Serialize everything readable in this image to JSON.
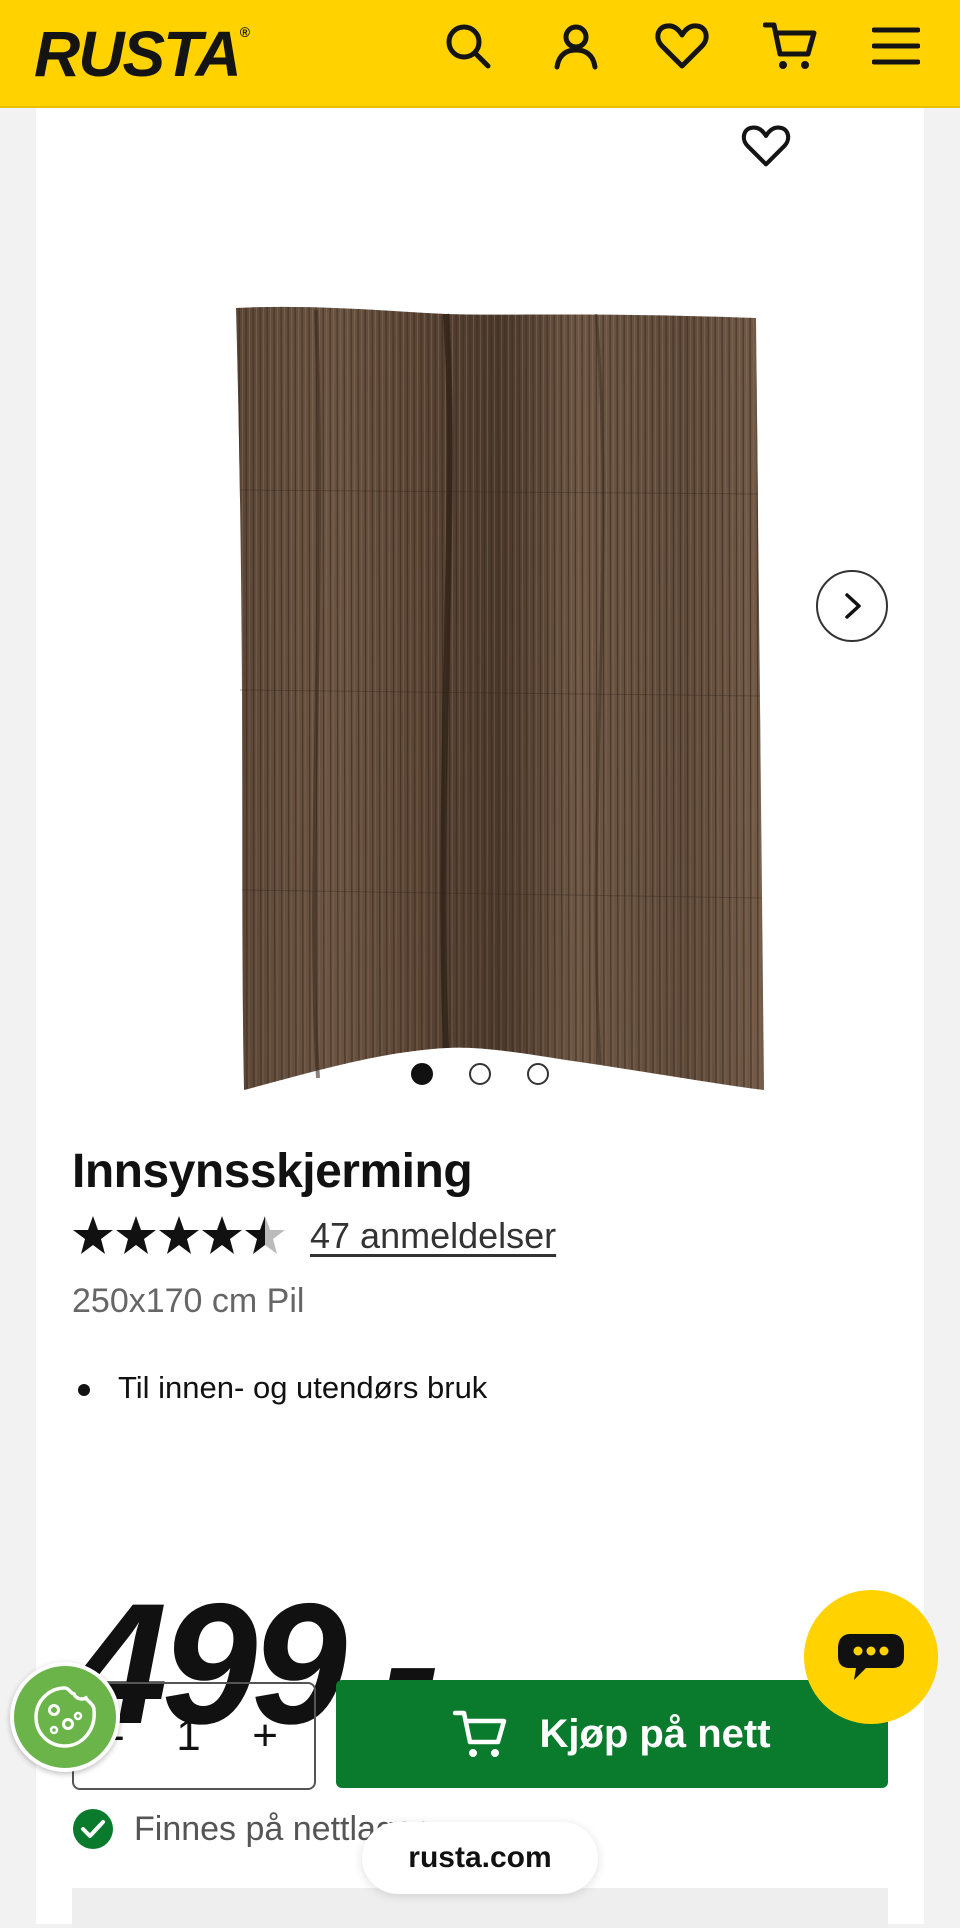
{
  "header": {
    "logo_text": "RUSTA",
    "brand_color": "#ffd200",
    "icons": [
      "search-icon",
      "account-icon",
      "heart-icon",
      "cart-icon",
      "menu-icon"
    ]
  },
  "gallery": {
    "image_count": 3,
    "active_index": 0,
    "next_icon": "chevron-right-icon",
    "favorite_icon": "heart-icon"
  },
  "product": {
    "title": "Innsynsskjerming",
    "rating": 4.5,
    "reviews_label": "47 anmeldelser",
    "variant": "250x170 cm Pil",
    "features": [
      "Til innen- og utendørs bruk"
    ],
    "price": "499.-"
  },
  "purchase": {
    "quantity": "1",
    "minus_label": "-",
    "plus_label": "+",
    "buy_label": "Kjøp på nett",
    "buy_color": "#0a7a2c",
    "stock_label": "Finnes på nettlager"
  },
  "browser": {
    "url": "rusta.com"
  }
}
